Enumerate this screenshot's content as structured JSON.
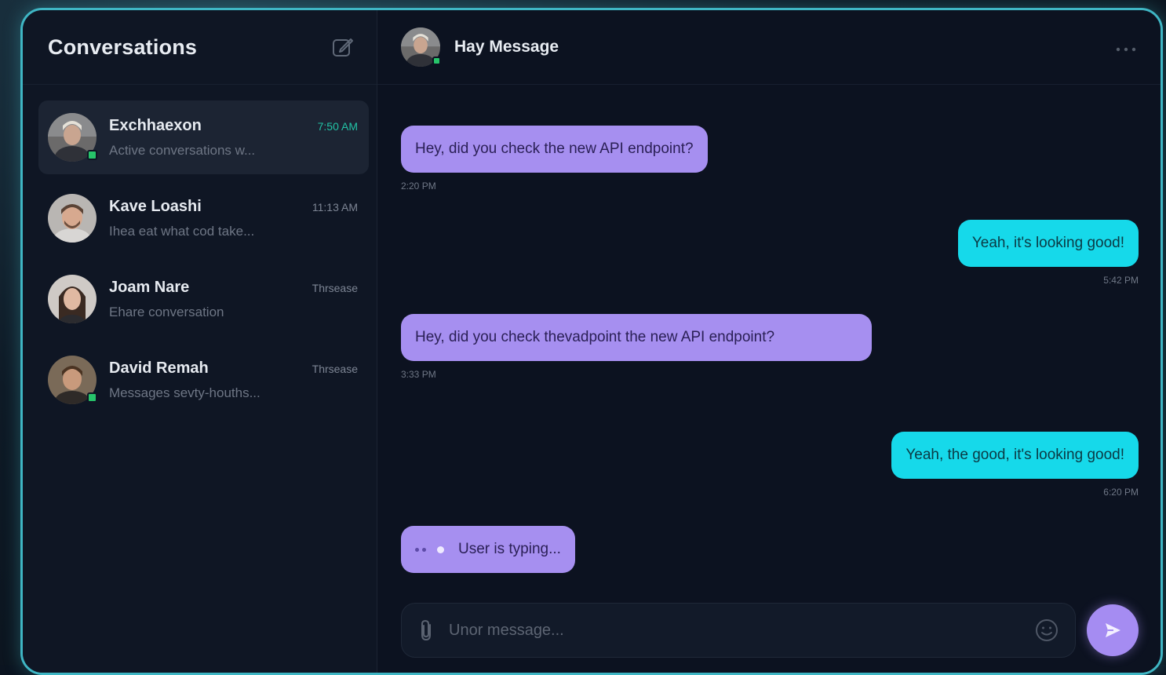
{
  "sidebar": {
    "title": "Conversations",
    "conversations": [
      {
        "name": "Exchhaexon",
        "time": "7:50 AM",
        "preview": "Active conversations w...",
        "online": true,
        "active": true
      },
      {
        "name": "Kave Loashi",
        "time": "11:13 AM",
        "preview": "Ihea eat what cod take...",
        "online": false,
        "active": false
      },
      {
        "name": "Joam Nare",
        "time": "Thrsease",
        "preview": "Ehare conversation",
        "online": false,
        "active": false
      },
      {
        "name": "David Remah",
        "time": "Thrsease",
        "preview": "Messages sevty-houths...",
        "online": true,
        "active": false
      }
    ]
  },
  "chat": {
    "title": "Hay Message",
    "messages": [
      {
        "direction": "in",
        "text": "Hey, did you check the new API endpoint?",
        "time": "2:20 PM"
      },
      {
        "direction": "out",
        "text": "Yeah, it's looking good!",
        "time": "5:42 PM"
      },
      {
        "direction": "in",
        "text": "Hey, did you check thevadpoint the new API endpoint?",
        "time": "3:33 PM"
      },
      {
        "direction": "out",
        "text": "Yeah, the good, it's looking good!",
        "time": "6:20 PM"
      }
    ],
    "typing_text": "User is typing...",
    "composer_placeholder": "Unor message..."
  },
  "colors": {
    "accent_border": "#3fb6c4",
    "incoming_bubble": "#a68ff0",
    "outgoing_bubble": "#16d9ea",
    "online": "#27c46a",
    "send_button": "#a58cf2"
  },
  "icons": {
    "compose": "compose-icon",
    "more": "more-icon",
    "attach": "paperclip-icon",
    "emoji": "emoji-icon",
    "send": "send-icon"
  }
}
